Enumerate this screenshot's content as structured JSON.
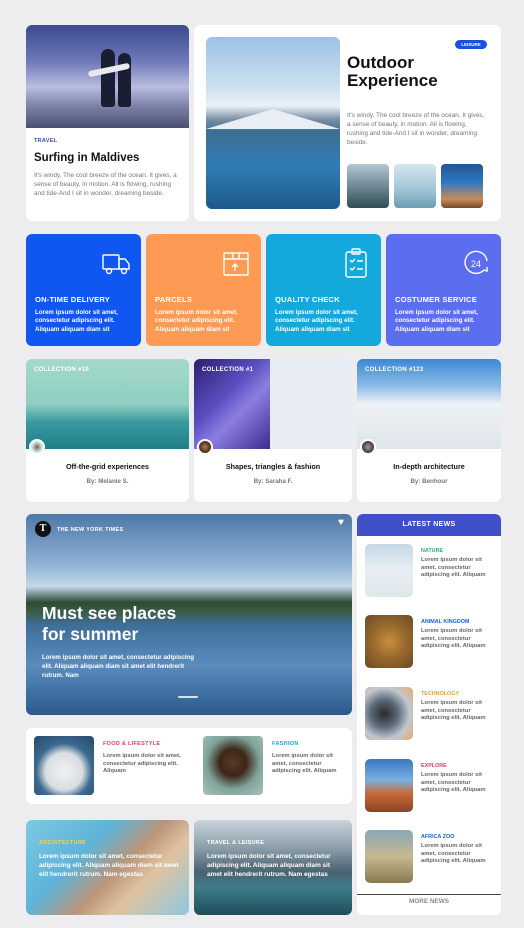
{
  "surf": {
    "category": "TRAVEL",
    "title": "Surfing in Maldives",
    "text": "It's windy. The cool breeze of the ocean. It gives, a sense of beauty, in motion. All is flowing, rushing and tide-And I sit in wonder, dreaming beside."
  },
  "outdoor": {
    "badge": "LEISURE",
    "title": "Outdoor Experience",
    "text": "It's windy. The cool breeze of the ocean. It gives, a sense of beauty, in motion. All is flowing, rushing and tide-And I sit in wonder, dreaming beside."
  },
  "services": [
    {
      "title": "ON-TIME DELIVERY",
      "text": "Lorem ipsum dolor sit amet, consectetur adipiscing elit. Aliquam aliquam diam sit",
      "color": "#0f57f0",
      "icon": "delivery-truck-icon"
    },
    {
      "title": "PARCELS",
      "text": "Lorem ipsum dolor sit amet, consectetur adipiscing elit. Aliquam aliquam diam sit",
      "color": "#ff9a55",
      "icon": "parcel-box-icon"
    },
    {
      "title": "QUALITY CHECK",
      "text": "Lorem ipsum dolor sit amet, consectetur adipiscing elit. Aliquam aliquam diam sit",
      "color": "#13a9dc",
      "icon": "checklist-icon"
    },
    {
      "title": "COSTUMER SERVICE",
      "text": "Lorem ipsum dolor sit amet, consectetur adipiscing elit. Aliquam aliquam diam sit",
      "color": "#5b6ef0",
      "icon": "support-24-icon"
    }
  ],
  "collections": [
    {
      "label": "COLLECTION #10",
      "title": "Off-the-grid experiences",
      "author": "By: Melanie S."
    },
    {
      "label": "COLLECTION #1",
      "title": "Shapes, triangles & fashion",
      "author": "By: Saraha F."
    },
    {
      "label": "COLLECTION #123",
      "title": "In-depth architecture",
      "author": "By: Benhour"
    }
  ],
  "feature": {
    "source": "THE NEW YORK TIMES",
    "logo_letter": "T",
    "title_line1": "Must see places",
    "title_line2": "for summer",
    "text": "Lorem ipsum dolor sit amet, consectetur adipiscing elit. Aliquam aliquam diam sit amet elit hendrerit rutrum. Nam"
  },
  "small_articles": [
    {
      "category": "FOOD & LIFESTYLE",
      "text": "Lorem ipsum dolor sit amet, consectetur adipiscing elit. Aliquam",
      "color": "#e03d6b"
    },
    {
      "category": "FASHION",
      "text": "Lorem ipsum dolor sit amet, consectetur adipiscing elit. Aliquam",
      "color": "#13a9dc"
    }
  ],
  "bottom_cards": [
    {
      "category": "ARCHITECTURE",
      "text": "Lorem ipsum dolor sit amet, consectetur adipiscing elit. Aliquam aliquam diam sit amet elit hendrerit rutrum. Nam egestas",
      "color": "#ffd23a"
    },
    {
      "category": "TRAVEL & LEISURE",
      "text": "Lorem ipsum dolor sit amet, consectetur adipiscing elit. Aliquam aliquam diam sit amet elit hendrerit rutrum. Nam egestas",
      "color": "#ffffff"
    }
  ],
  "latest_news": {
    "header": "LATEST NEWS",
    "items": [
      {
        "category": "NATURE",
        "text": "Lorem ipsum dolor sit amet, consectetur adipiscing elit. Aliquam",
        "color": "#2fb36a"
      },
      {
        "category": "ANIMAL KINGDOM",
        "text": "Lorem ipsum dolor sit amet, consectetur adipiscing elit. Aliquam",
        "color": "#1a5fd8"
      },
      {
        "category": "TECHNOLOGY",
        "text": "Lorem ipsum dolor sit amet, consectetur adipiscing elit. Aliquam",
        "color": "#f0a020"
      },
      {
        "category": "EXPLORE",
        "text": "Lorem ipsum dolor sit amet, consectetur adipiscing elit. Aliquam",
        "color": "#e03d6b"
      },
      {
        "category": "AFRICA ZOO",
        "text": "Lorem ipsum dolor sit amet, consectetur adipiscing elit. Aliquam",
        "color": "#1a5fd8"
      }
    ],
    "more": "MORE NEWS"
  },
  "colors": {
    "news_header": "#3f4fc7",
    "badge": "#1a4fe0"
  }
}
